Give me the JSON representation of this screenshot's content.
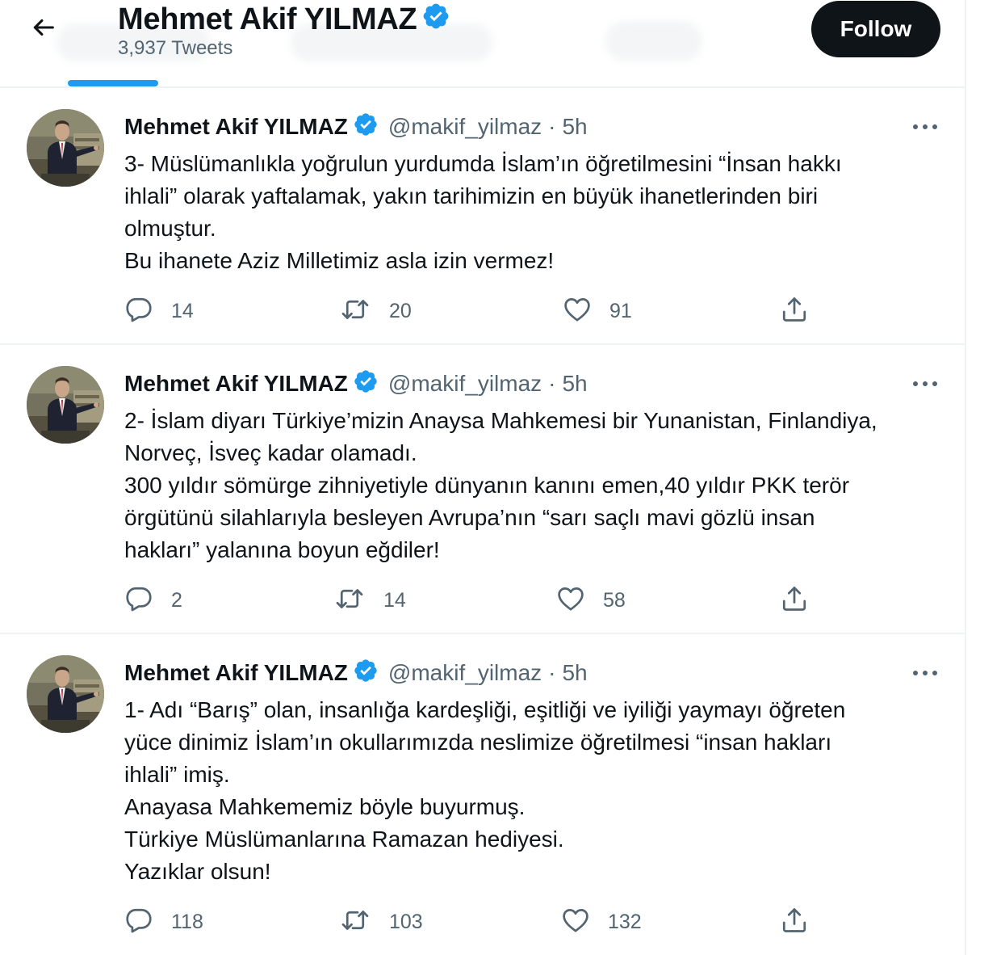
{
  "header": {
    "name": "Mehmet Akif YILMAZ",
    "tweet_count": "3,937 Tweets",
    "follow_label": "Follow",
    "back_icon": "arrow-left-icon",
    "verified_icon": "verified-badge-icon"
  },
  "colors": {
    "accent": "#1d9bf0",
    "text_primary": "#0f1419",
    "text_secondary": "#536471",
    "divider": "#eff3f4",
    "follow_bg": "#0f1419"
  },
  "tweets": [
    {
      "author": "Mehmet Akif YILMAZ",
      "handle": "@makif_yilmaz",
      "separator": "·",
      "time": "5h",
      "text": "3- Müslümanlıkla yoğrulun yurdumda İslam’ın öğretilmesini “İnsan hakkı\nihlali” olarak yaftalamak, yakın tarihimizin en büyük ihanetlerinden biri\nolmuştur.\nBu ihanete Aziz Milletimiz asla izin vermez!",
      "replies": "14",
      "retweets": "20",
      "likes": "91"
    },
    {
      "author": "Mehmet Akif YILMAZ",
      "handle": "@makif_yilmaz",
      "separator": "·",
      "time": "5h",
      "text": "2- İslam diyarı Türkiye’mizin Anaysa Mahkemesi bir Yunanistan, Finlandiya,\nNorveç, İsveç kadar olamadı.\n300 yıldır sömürge zihniyetiyle dünyanın kanını emen,40 yıldır PKK terör\nörgütünü silahlarıyla besleyen Avrupa’nın “sarı saçlı mavi gözlü insan\nhakları” yalanına boyun eğdiler!",
      "replies": "2",
      "retweets": "14",
      "likes": "58"
    },
    {
      "author": "Mehmet Akif YILMAZ",
      "handle": "@makif_yilmaz",
      "separator": "·",
      "time": "5h",
      "text": "1- Adı “Barış” olan, insanlığa kardeşliği, eşitliği ve iyiliği yaymayı öğreten\nyüce dinimiz İslam’ın okullarımızda neslimize öğretilmesi “insan hakları\nihlali” imiş.\nAnayasa Mahkememiz böyle buyurmuş.\nTürkiye Müslümanlarına Ramazan hediyesi.\nYazıklar olsun!",
      "replies": "118",
      "retweets": "103",
      "likes": "132"
    }
  ],
  "icons": {
    "reply": "reply-icon",
    "retweet": "retweet-icon",
    "like": "heart-icon",
    "share": "share-icon",
    "more": "more-icon"
  }
}
